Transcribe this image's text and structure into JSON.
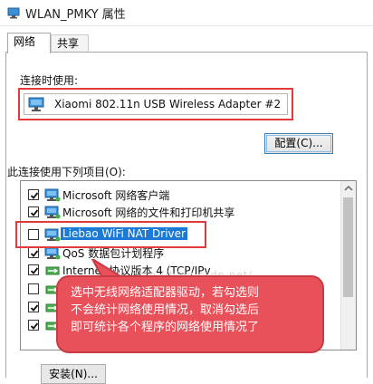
{
  "window": {
    "title": "WLAN_PMKY 属性"
  },
  "tabs": [
    {
      "label": "网络",
      "active": true
    },
    {
      "label": "共享",
      "active": false
    }
  ],
  "connect_using": {
    "label": "连接时使用:",
    "adapter": "Xiaomi 802.11n USB Wireless Adapter #2",
    "configure_button": "配置(C)..."
  },
  "items_section": {
    "label": "此连接使用下列项目(O):",
    "items": [
      {
        "label": "Microsoft 网络客户端",
        "checked": true,
        "selected": false,
        "icon": "network-client-icon"
      },
      {
        "label": "Microsoft 网络的文件和打印机共享",
        "checked": true,
        "selected": false,
        "icon": "network-client-icon"
      },
      {
        "label": "Liebao WiFi NAT Driver",
        "checked": false,
        "selected": true,
        "icon": "network-client-icon"
      },
      {
        "label": "QoS 数据包计划程序",
        "checked": true,
        "selected": false,
        "icon": "network-client-icon"
      },
      {
        "label": "Internet 协议版本 4 (TCP/IPv",
        "checked": true,
        "selected": false,
        "icon": "protocol-icon"
      },
      {
        "label": "",
        "checked": false,
        "selected": false,
        "icon": "protocol-icon"
      },
      {
        "label": "",
        "checked": true,
        "selected": false,
        "icon": "protocol-icon"
      },
      {
        "label": "",
        "checked": true,
        "selected": false,
        "icon": "protocol-icon"
      }
    ]
  },
  "annotation": {
    "lines": [
      "选中无线网络适配器驱动，若勾选则",
      "不会统计网络使用情况，取消勾选后",
      "即可统计各个程序的网络使用情况了"
    ]
  },
  "watermark": "http://blog.csdn.net/",
  "bottom": {
    "install_button": "安装(N)..."
  },
  "colors": {
    "accent_red": "#e23b3b",
    "callout_fill": "#e8505a",
    "selection_blue": "#1c79d4"
  }
}
